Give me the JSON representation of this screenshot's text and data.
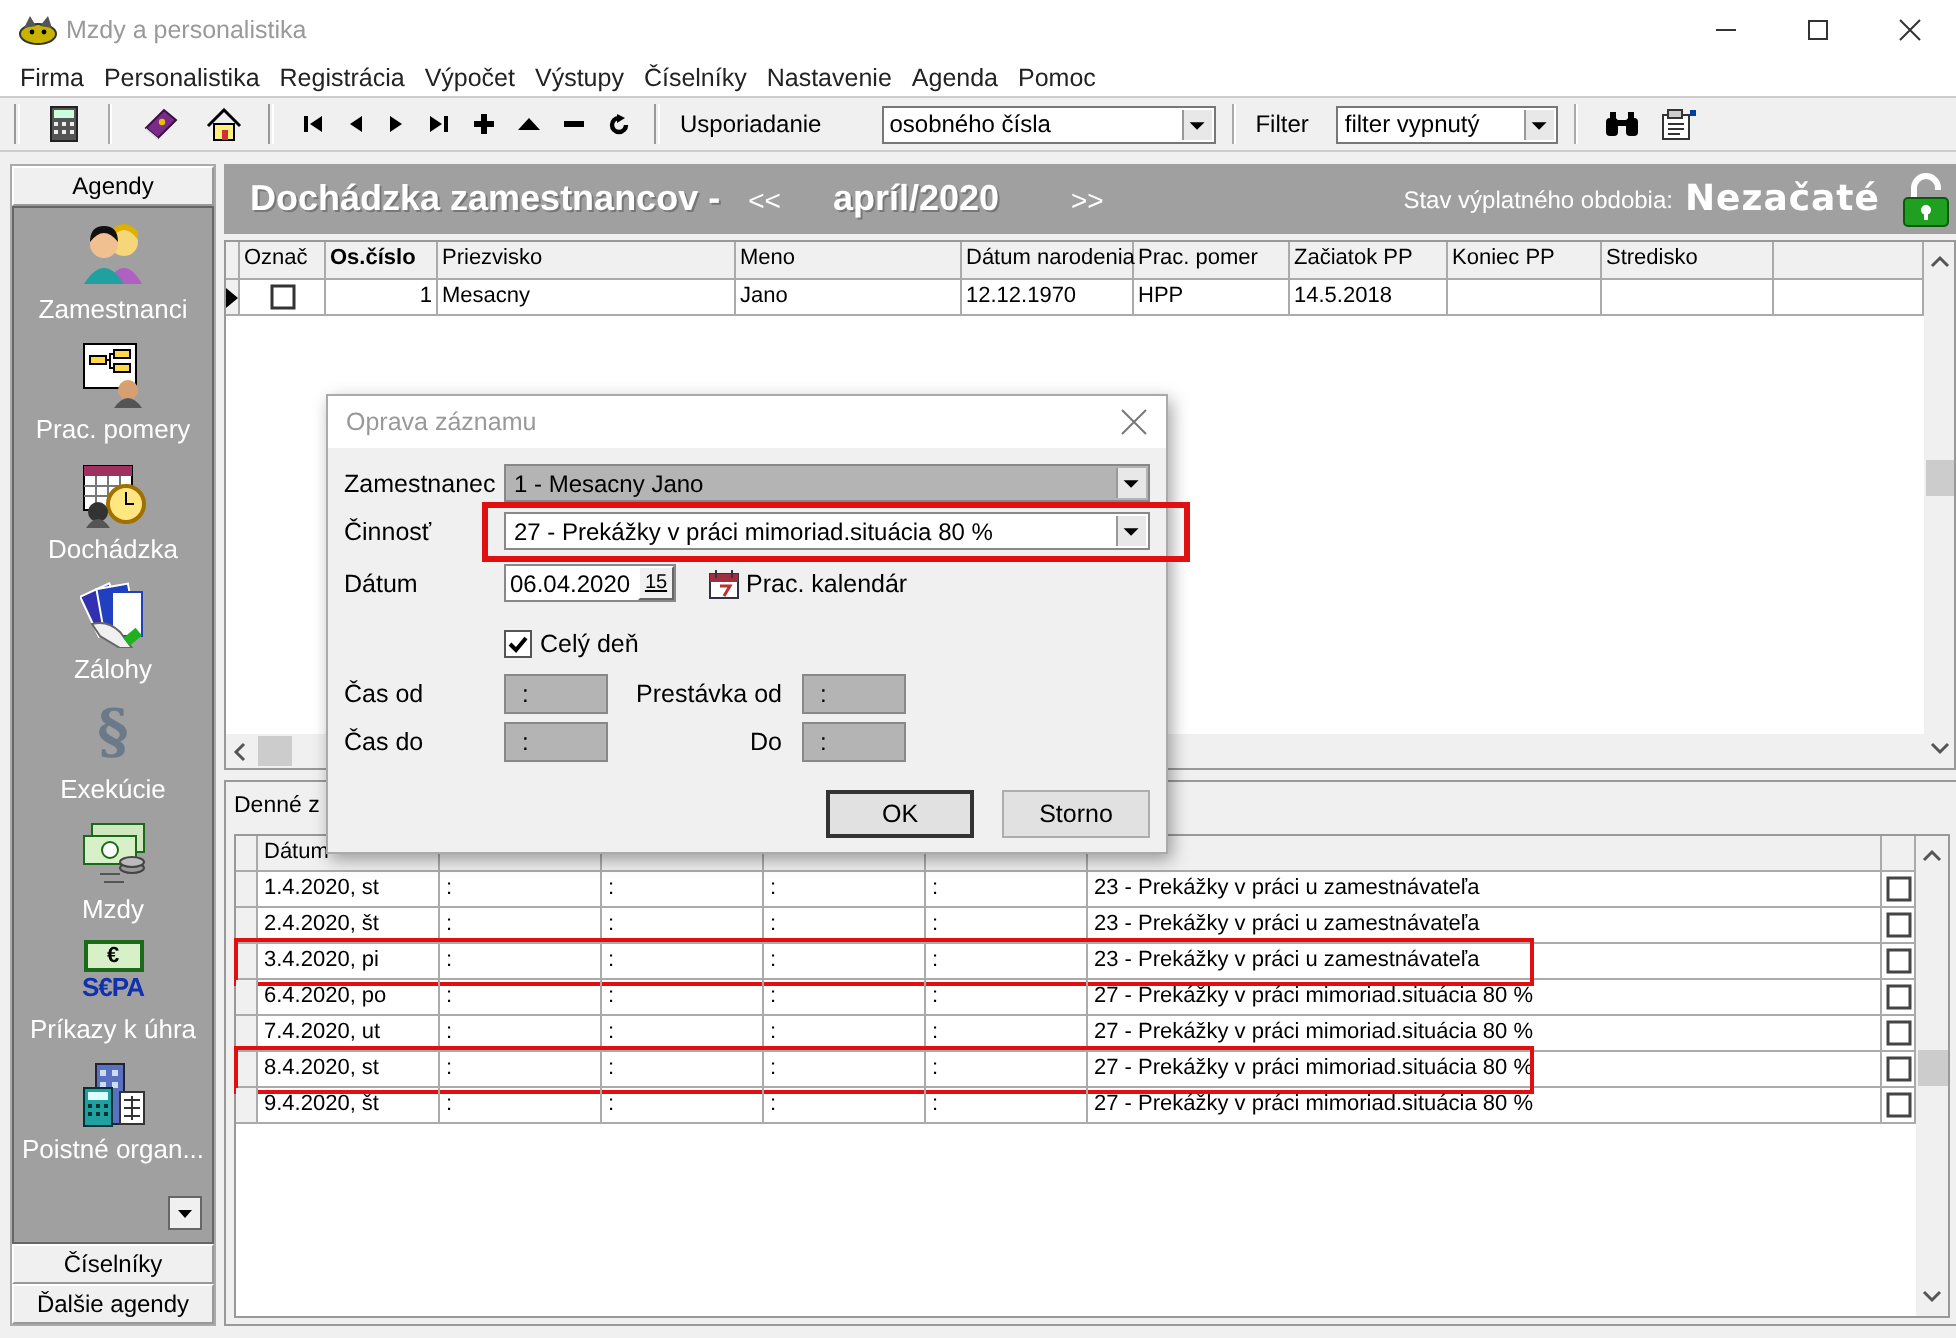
{
  "window": {
    "title": "Mzdy a personalistika"
  },
  "menu": [
    "Firma",
    "Personalistika",
    "Registrácia",
    "Výpočet",
    "Výstupy",
    "Číselníky",
    "Nastavenie",
    "Agenda",
    "Pomoc"
  ],
  "toolbar": {
    "buttons": [
      {
        "kind": "calculator"
      },
      {
        "kind": "book"
      },
      {
        "kind": "home"
      },
      {
        "kind": "first"
      },
      {
        "kind": "previous"
      },
      {
        "kind": "next"
      },
      {
        "kind": "last"
      },
      {
        "kind": "add"
      },
      {
        "kind": "up"
      },
      {
        "kind": "remove"
      },
      {
        "kind": "refresh"
      }
    ],
    "sort": {
      "label": "Usporiadanie",
      "value": "osobného čísla"
    },
    "filter": {
      "label": "Filter",
      "value": "filter vypnutý"
    },
    "tools": [
      {
        "kind": "find"
      },
      {
        "kind": "properties"
      }
    ]
  },
  "sidebar": {
    "header": "Agendy",
    "items": [
      {
        "label": "Zamestnanci",
        "kind": "people"
      },
      {
        "label": "Prac. pomery",
        "kind": "org"
      },
      {
        "label": "Dochádzka",
        "kind": "calendar"
      },
      {
        "label": "Zálohy",
        "kind": "cards"
      },
      {
        "label": "Exekúcie",
        "kind": "paragraph",
        "glyph": "§"
      },
      {
        "label": "Mzdy",
        "kind": "money"
      },
      {
        "label": "Príkazy k úhra",
        "kind": "sepa",
        "glyph": "€",
        "mark": "S€PA"
      },
      {
        "label": "Poistné organ...",
        "kind": "building"
      }
    ],
    "footer": [
      "Číselníky",
      "Ďalšie agendy"
    ]
  },
  "header": {
    "title": "Dochádzka zamestnancov -",
    "previous": "<<",
    "period": "apríl/2020",
    "next": ">>",
    "status_label": "Stav výplatného obdobia:",
    "status": "Nezačaté",
    "locked": false
  },
  "employees": {
    "mark_column": "Označ",
    "columns": [
      {
        "label": "Os.číslo",
        "kind": "number",
        "sorted": true
      },
      {
        "label": "Priezvisko",
        "kind": "text",
        "sorted": false
      },
      {
        "label": "Meno",
        "kind": "text",
        "sorted": false
      },
      {
        "label": "Dátum narodenia",
        "kind": "text",
        "sorted": false
      },
      {
        "label": "Prac. pomer",
        "kind": "text",
        "sorted": false
      },
      {
        "label": "Začiatok PP",
        "kind": "text",
        "sorted": false
      },
      {
        "label": "Koniec PP",
        "kind": "text",
        "sorted": false
      },
      {
        "label": "Stredisko",
        "kind": "text",
        "sorted": false
      }
    ],
    "rows": [
      {
        "selected": true,
        "marked": false,
        "cells": [
          "1",
          "Mesacny",
          "Jano",
          "12.12.1970",
          "HPP",
          "14.5.2018"
        ]
      }
    ]
  },
  "daily": {
    "title": "Denné z",
    "columns": [
      "Dátum"
    ],
    "rows": [
      {
        "cells": [
          "1.4.2020, st",
          ":",
          ":",
          ":",
          ":",
          "23 - Prekážky v práci u zamestnávateľa"
        ],
        "checked": false,
        "highlighted": false
      },
      {
        "cells": [
          "2.4.2020, št",
          ":",
          ":",
          ":",
          ":",
          "23 - Prekážky v práci u zamestnávateľa"
        ],
        "checked": false,
        "highlighted": false
      },
      {
        "cells": [
          "3.4.2020, pi",
          ":",
          ":",
          ":",
          ":",
          "23 - Prekážky v práci u zamestnávateľa"
        ],
        "checked": false,
        "highlighted": true
      },
      {
        "cells": [
          "6.4.2020, po",
          ":",
          ":",
          ":",
          ":",
          "27 - Prekážky v práci mimoriad.situácia 80 %"
        ],
        "checked": false,
        "highlighted": false
      },
      {
        "cells": [
          "7.4.2020, ut",
          ":",
          ":",
          ":",
          ":",
          "27 - Prekážky v práci mimoriad.situácia 80 %"
        ],
        "checked": false,
        "highlighted": false
      },
      {
        "cells": [
          "8.4.2020, st",
          ":",
          ":",
          ":",
          ":",
          "27 - Prekážky v práci mimoriad.situácia 80 %"
        ],
        "checked": false,
        "highlighted": true
      },
      {
        "cells": [
          "9.4.2020, št",
          ":",
          ":",
          ":",
          ":",
          "27 - Prekážky v práci mimoriad.situácia 80 %"
        ],
        "checked": false,
        "highlighted": false
      }
    ]
  },
  "dialog": {
    "title": "Oprava záznamu",
    "combos": [
      {
        "label": "Zamestnanec",
        "value": "1 - Mesacny Jano",
        "disabled": true,
        "highlighted": false
      },
      {
        "label": "Činnosť",
        "value": "27 - Prekážky v práci mimoriad.situácia 80 %",
        "disabled": false,
        "highlighted": true
      }
    ],
    "date": {
      "label": "Dátum",
      "value": "06.04.2020",
      "button": "15",
      "link": "Prac. kalendár"
    },
    "full_day": {
      "label": "Celý deň",
      "checked": true
    },
    "times": [
      {
        "label": "Čas od",
        "value": ":",
        "disabled": true
      },
      {
        "label": "Čas do",
        "value": ":",
        "disabled": true
      }
    ],
    "breaks": [
      {
        "label": "Prestávka od",
        "value": ":",
        "disabled": true
      },
      {
        "label": "Do",
        "value": ":",
        "disabled": true
      }
    ],
    "buttons": [
      {
        "label": "OK",
        "default": true
      },
      {
        "label": "Storno",
        "default": false
      }
    ]
  }
}
